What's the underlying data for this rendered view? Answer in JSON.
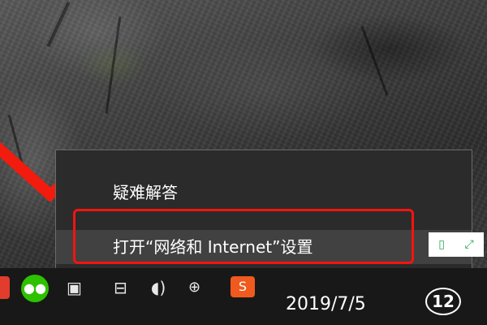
{
  "context_menu": {
    "items": [
      {
        "label": "疑难解答"
      },
      {
        "label": "打开“网络和 Internet”设置"
      }
    ]
  },
  "taskbar": {
    "date": "2019/7/5",
    "notification_count": "12",
    "icons": [
      "app-icon-red",
      "wechat-icon",
      "network-icon",
      "volume-icon",
      "ime-icon",
      "app-icon-orange",
      "notification-icon"
    ]
  },
  "side_widget": {
    "icons": [
      "phone-icon",
      "expand-icon"
    ]
  },
  "colors": {
    "annotation_red": "#f21b0d",
    "menu_background": "#2b2b2b",
    "menu_hover": "#414141",
    "taskbar_background": "#181818"
  }
}
